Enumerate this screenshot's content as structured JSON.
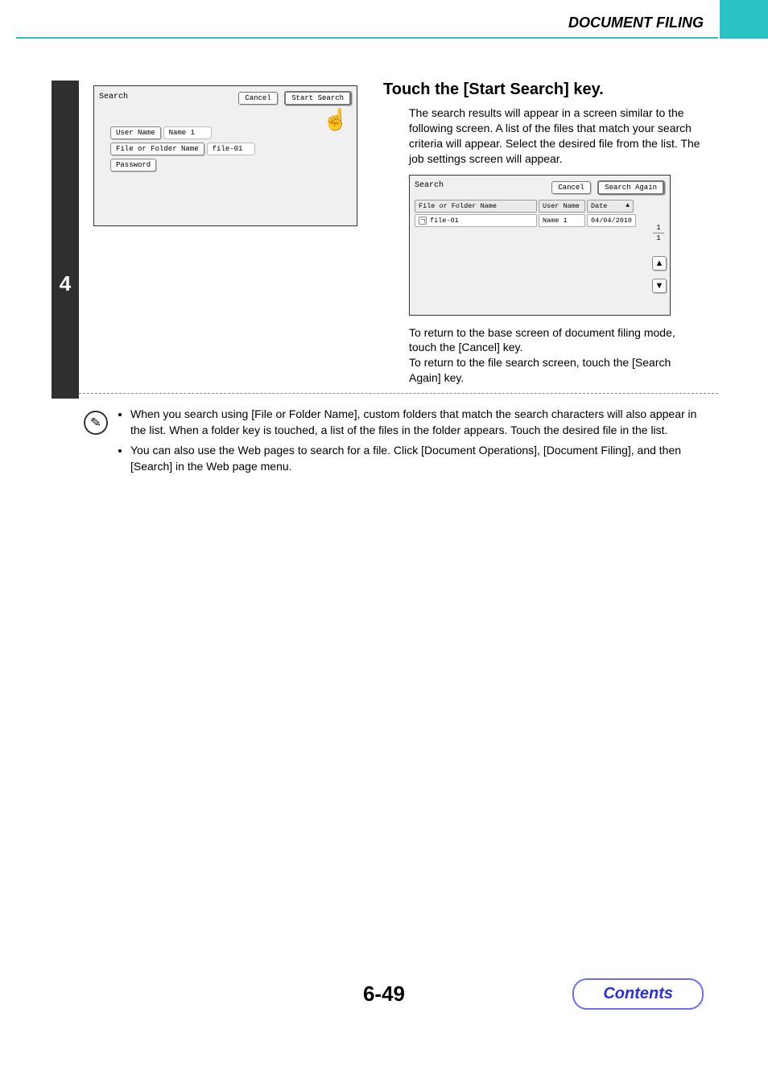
{
  "header": {
    "title": "DOCUMENT FILING"
  },
  "step": {
    "number": "4"
  },
  "search_panel": {
    "title": "Search",
    "cancel": "Cancel",
    "start_search": "Start Search",
    "user_name_label": "User Name",
    "user_name_value": "Name 1",
    "file_folder_label": "File or Folder Name",
    "file_folder_value": "file-01",
    "password_label": "Password"
  },
  "instruction": {
    "heading": "Touch the [Start Search] key.",
    "body": "The search results will appear in a screen similar to the following screen. A list of the files that match your search criteria will appear. Select the desired file from the list. The job settings screen will appear.",
    "post1": "To return to the base screen of document filing mode, touch the [Cancel] key.",
    "post2": "To return to the file search screen, touch the [Search Again] key."
  },
  "results_panel": {
    "title": "Search",
    "cancel": "Cancel",
    "search_again": "Search Again",
    "col_file": "File or Folder Name",
    "col_user": "User Name",
    "col_date": "Date",
    "row_file": "file-01",
    "row_user": "Name 1",
    "row_date": "04/04/2010",
    "page_cur": "1",
    "page_total": "1"
  },
  "notes": {
    "item1": "When you search using [File or Folder Name], custom folders that match the search characters will also appear in the list. When a folder key is touched, a list of the files in the folder appears. Touch the desired file in the list.",
    "item2": "You can also use the Web pages to search for a file. Click [Document Operations], [Document Filing], and then [Search] in the Web page menu."
  },
  "footer": {
    "page": "6-49",
    "contents": "Contents"
  }
}
